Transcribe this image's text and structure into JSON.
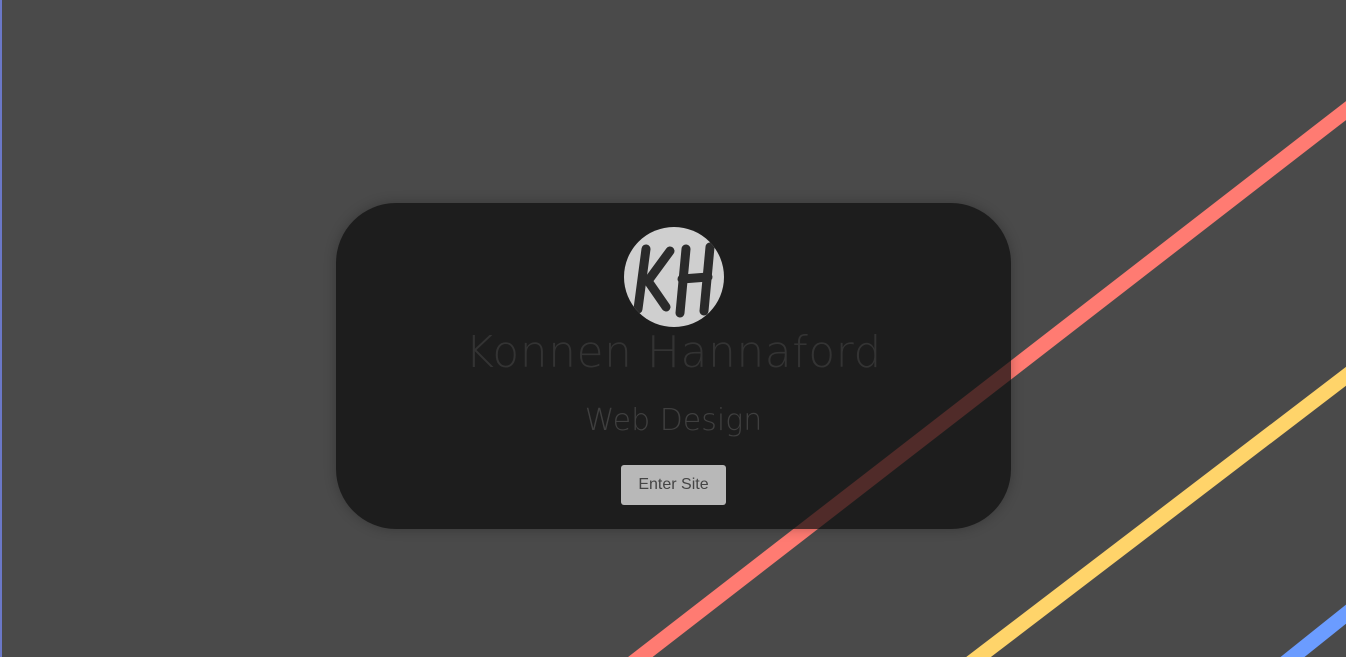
{
  "profile": {
    "logo_initials": "KH",
    "name": "Konnen Hannaford",
    "tagline": "Web Design",
    "enter_label": "Enter Site"
  },
  "colors": {
    "background": "#4a4a4a",
    "card": "#151515",
    "stripe_red": "#ff7b72",
    "stripe_yellow": "#ffd46a",
    "stripe_blue": "#6b9cff",
    "button": "#b8b8b8"
  }
}
